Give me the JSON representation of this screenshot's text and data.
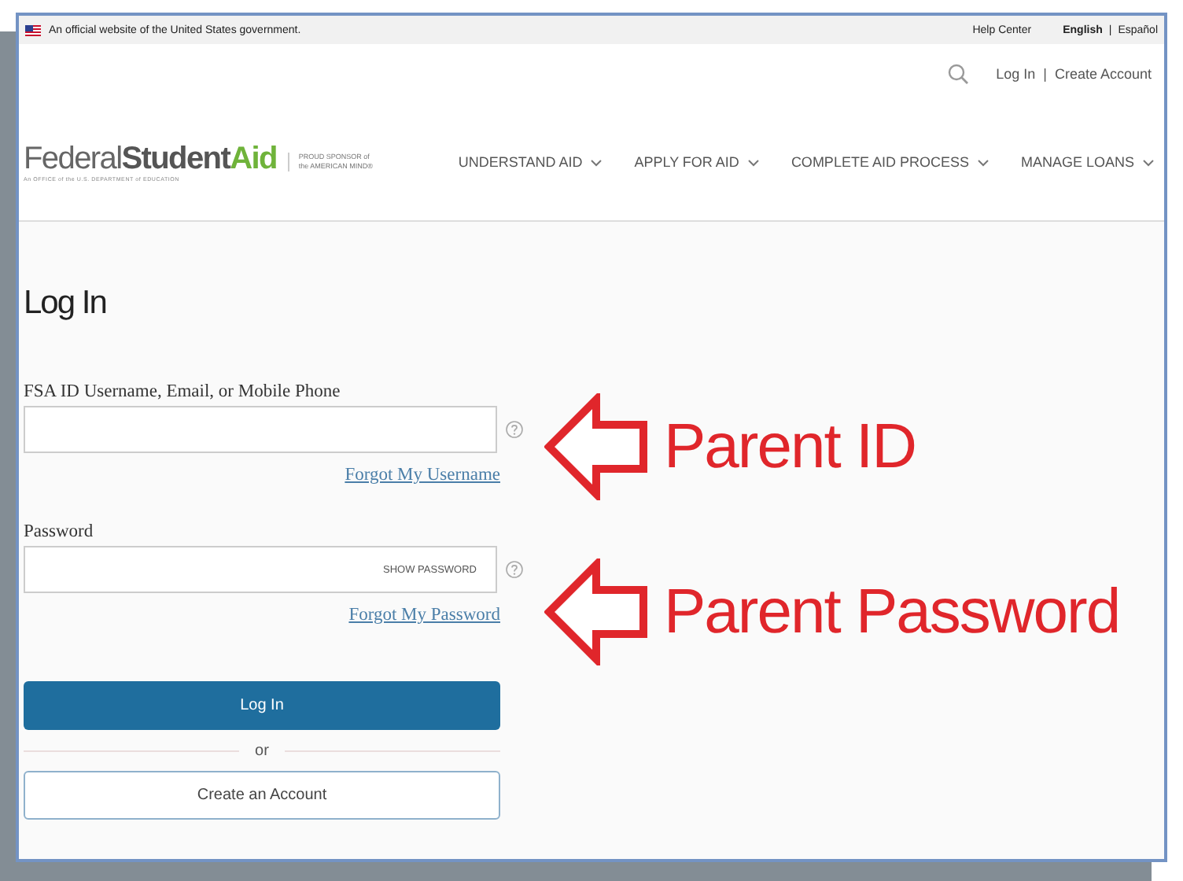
{
  "gov_banner": {
    "text": "An official website of the United States government.",
    "help": "Help Center",
    "separator": "|",
    "languages": [
      {
        "label": "English",
        "selected": true
      },
      {
        "label": "Español",
        "selected": false
      }
    ]
  },
  "account_links": {
    "items": [
      "Log In",
      "Create Account"
    ],
    "separator": "|"
  },
  "logo": {
    "parts": [
      {
        "text": "Federal",
        "kind": "light"
      },
      {
        "text": "Student",
        "kind": "bold"
      },
      {
        "text": "Aid",
        "kind": "accent"
      }
    ],
    "subtitle": "An OFFICE of the U.S. DEPARTMENT of EDUCATION",
    "sponsor": [
      "PROUD SPONSOR of",
      "the AMERICAN MIND®"
    ]
  },
  "nav": [
    {
      "label": "UNDERSTAND AID"
    },
    {
      "label": "APPLY FOR AID"
    },
    {
      "label": "COMPLETE AID PROCESS"
    },
    {
      "label": "MANAGE LOANS"
    }
  ],
  "login": {
    "heading": "Log In",
    "fields": [
      {
        "kind": "text",
        "label": "FSA ID Username, Email, or Mobile Phone",
        "link": "Forgot My Username"
      },
      {
        "kind": "password",
        "label": "Password",
        "toggle": "SHOW PASSWORD",
        "link": "Forgot My Password"
      }
    ],
    "primary_button": "Log In",
    "divider": "or",
    "secondary_button": "Create an Account"
  },
  "annotations": [
    {
      "text": "Parent ID"
    },
    {
      "text": "Parent Password"
    }
  ]
}
